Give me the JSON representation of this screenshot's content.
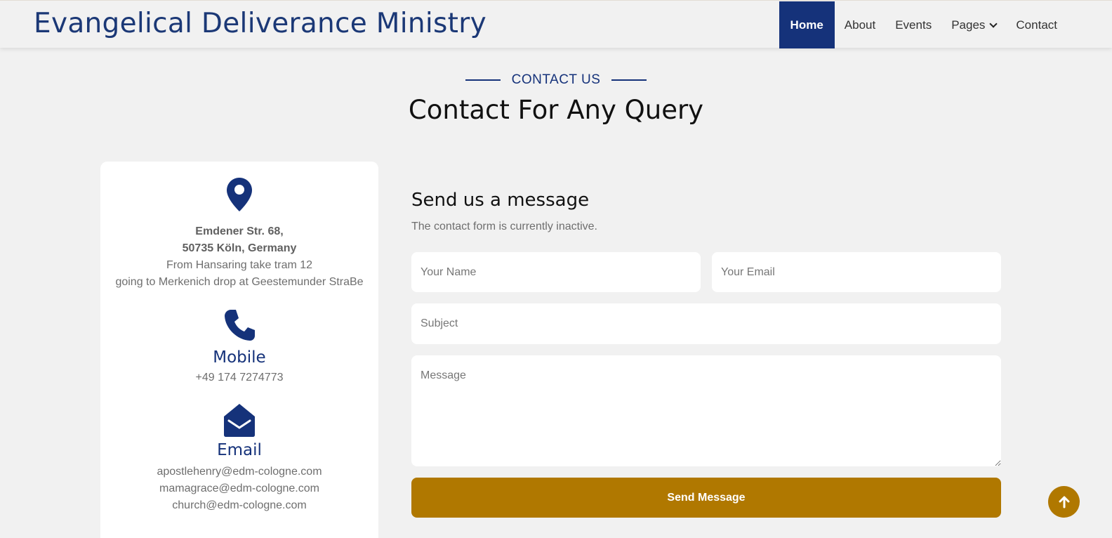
{
  "brand": {
    "name": "Evangelical Deliverance Ministry"
  },
  "nav": {
    "items": [
      {
        "label": "Home",
        "active": true
      },
      {
        "label": "About"
      },
      {
        "label": "Events"
      },
      {
        "label": "Pages",
        "dropdown": true
      },
      {
        "label": "Contact"
      }
    ]
  },
  "section": {
    "eyebrow": "Contact Us",
    "title": "Contact For Any Query"
  },
  "info": {
    "address_icon": "map-marker-icon",
    "address_line1": "Emdener Str. 68,",
    "address_line2": "50735 Köln, Germany",
    "directions_line1": "From Hansaring take tram 12",
    "directions_line2": "going to Merkenich drop at Geestemunder StraBe",
    "mobile_icon": "phone-icon",
    "mobile_title": "Mobile",
    "mobile_number": "+49 174 7274773",
    "email_icon": "envelope-open-icon",
    "email_title": "Email",
    "emails": [
      "apostlehenry@edm-cologne.com",
      "mamagrace@edm-cologne.com",
      "church@edm-cologne.com"
    ]
  },
  "form": {
    "title": "Send us a message",
    "subtitle": "The contact form is currently inactive.",
    "name_placeholder": "Your Name",
    "email_placeholder": "Your Email",
    "subject_placeholder": "Subject",
    "message_placeholder": "Message",
    "submit_label": "Send Message"
  },
  "colors": {
    "primary": "#15327a",
    "accent": "#b07800",
    "background": "#f1f1f1"
  },
  "back_to_top": {
    "icon": "arrow-up-icon"
  }
}
